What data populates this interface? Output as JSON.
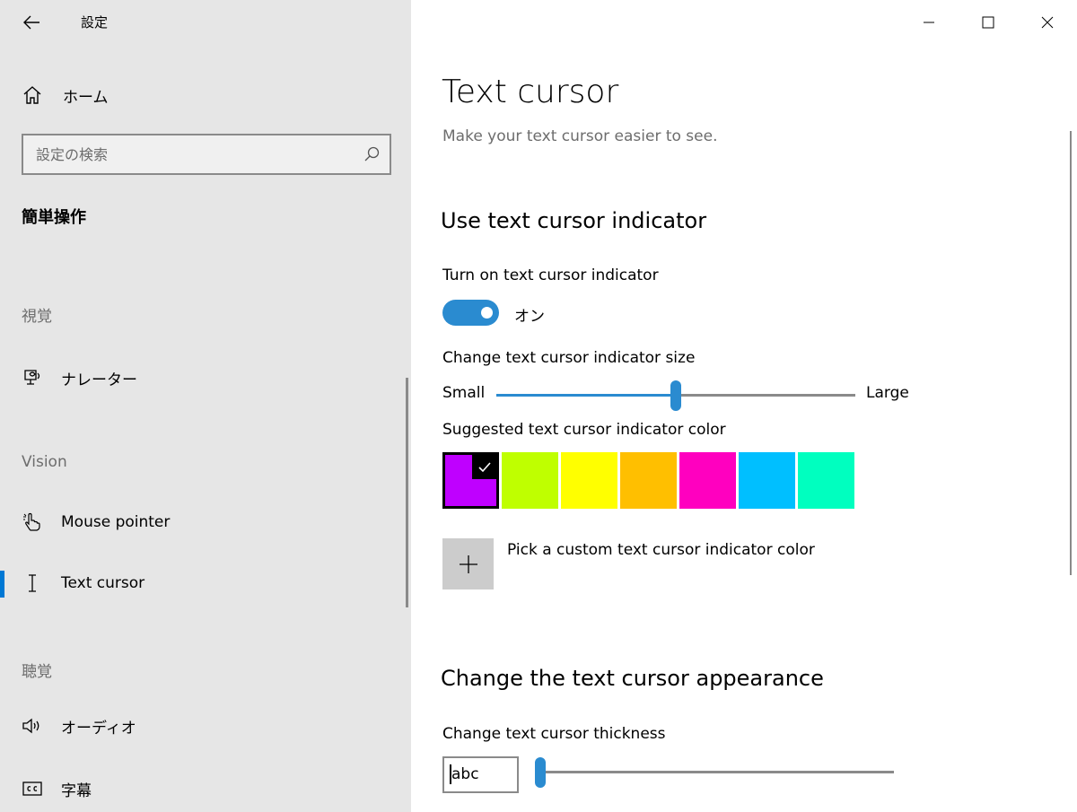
{
  "window": {
    "app_title": "設定"
  },
  "sidebar": {
    "home_label": "ホーム",
    "search_placeholder": "設定の検索",
    "category_title": "簡単操作",
    "sections": [
      {
        "label": "視覚",
        "items": [
          {
            "label": "ナレーター",
            "icon": "narrator-icon"
          }
        ]
      },
      {
        "label": "Vision",
        "items": [
          {
            "label": "Mouse pointer",
            "icon": "mouse-pointer-icon"
          },
          {
            "label": "Text cursor",
            "icon": "text-cursor-icon",
            "selected": true
          }
        ]
      },
      {
        "label": "聴覚",
        "items": [
          {
            "label": "オーディオ",
            "icon": "audio-icon"
          },
          {
            "label": "字幕",
            "icon": "captions-icon"
          }
        ]
      }
    ]
  },
  "content": {
    "title": "Text cursor",
    "subtitle": "Make your text cursor easier to see.",
    "indicator_section": {
      "heading": "Use text cursor indicator",
      "toggle_label": "Turn on text cursor indicator",
      "toggle_state": "オン",
      "toggle_on": true,
      "size_label": "Change text cursor indicator size",
      "size_min_label": "Small",
      "size_max_label": "Large",
      "size_value_fraction": 0.5,
      "color_label": "Suggested text cursor indicator color",
      "colors": [
        "#bf00ff",
        "#bfff00",
        "#ffff00",
        "#ffbf00",
        "#ff00bf",
        "#00bfff",
        "#00ffbf"
      ],
      "selected_color_index": 0,
      "custom_color_label": "Pick a custom text cursor indicator color"
    },
    "appearance_section": {
      "heading": "Change the text cursor appearance",
      "thickness_label": "Change text cursor thickness",
      "preview_text": "abc",
      "thickness_value_fraction": 0.0
    }
  },
  "colors": {
    "accent": "#2a8bd0",
    "sidebar_bg": "#e6e6e6",
    "secondary_text": "#6d6d6d"
  }
}
